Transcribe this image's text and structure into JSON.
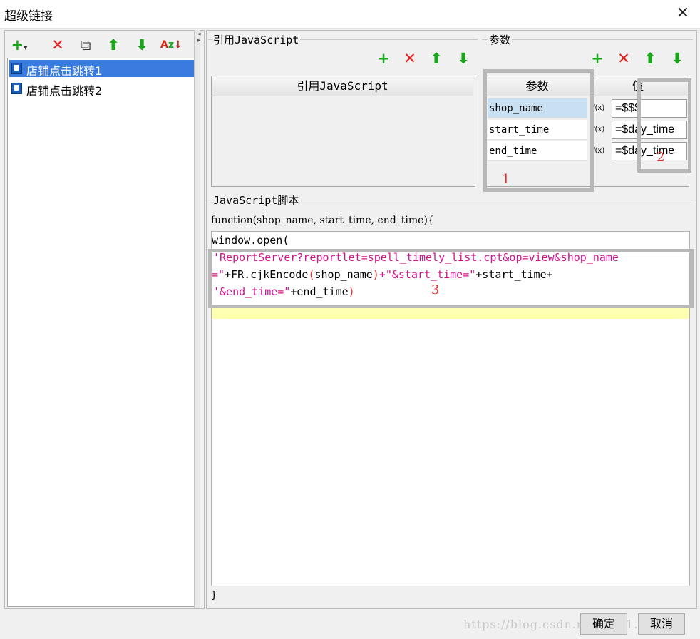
{
  "window": {
    "title": "超级链接",
    "close_glyph": "✕"
  },
  "left": {
    "toolbar": [
      {
        "name": "add-icon",
        "glyph": "+▾"
      },
      {
        "name": "delete-icon",
        "glyph": "✕"
      },
      {
        "name": "copy-icon",
        "glyph": "⧉"
      },
      {
        "name": "move-up-icon",
        "glyph": "⬆"
      },
      {
        "name": "move-down-icon",
        "glyph": "⬇"
      },
      {
        "name": "sort-icon",
        "glyph": "A↓"
      }
    ],
    "items": [
      {
        "label": "店铺点击跳转1",
        "selected": true
      },
      {
        "label": "店铺点击跳转2",
        "selected": false
      }
    ]
  },
  "ref_js": {
    "title": "引用JavaScript",
    "column": "引用JavaScript"
  },
  "params": {
    "title": "参数",
    "col_param": "参数",
    "col_value": "值",
    "rows": [
      {
        "name": "shop_name",
        "fx": "f(x)",
        "value": "=$$$"
      },
      {
        "name": "start_time",
        "fx": "f(x)",
        "value": "=$day_time"
      },
      {
        "name": "end_time",
        "fx": "f(x)",
        "value": "=$day_time"
      }
    ]
  },
  "script": {
    "title": "JavaScript脚本",
    "signature": "function(shop_name, start_time, end_time){",
    "line1": "window.open(",
    "line1_paren": "(",
    "line2": "'ReportServer?reportlet=spell_timely_list.cpt&op=view&shop_name",
    "line3_a": "=\"",
    "line3_b": "+FR.cjkEncode",
    "line3_c": "(",
    "line3_d": "shop_name",
    "line3_e": ")",
    "line3_f": "+\"&start_time=\"",
    "line3_g": "+start_time+",
    "line4_a": "'&end_time=\"",
    "line4_b": "+end_time",
    "line4_c": ")",
    "closing": "}"
  },
  "annotations": {
    "a1": "1",
    "a2": "2",
    "a3": "3"
  },
  "buttons": {
    "ok": "确定",
    "cancel": "取消"
  },
  "watermark": "https://blog.csdn.net/u011..73"
}
